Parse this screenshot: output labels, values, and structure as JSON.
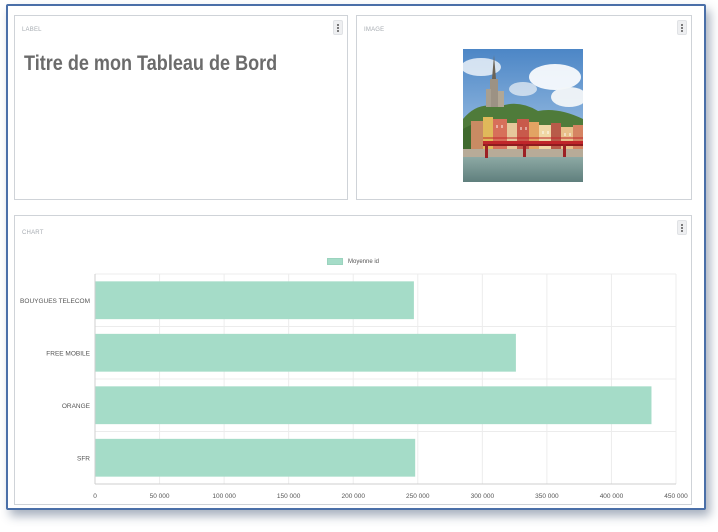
{
  "label_card": {
    "section_label": "LABEL",
    "title": "Titre de mon Tableau de Bord"
  },
  "image_card": {
    "section_label": "IMAGE",
    "image_alt": "Lyon"
  },
  "chart_card": {
    "section_label": "CHART"
  },
  "chart_data": {
    "type": "bar",
    "orientation": "horizontal",
    "categories": [
      "BOUYGUES TELECOM",
      "FREE MOBILE",
      "ORANGE",
      "SFR"
    ],
    "series": [
      {
        "name": "Moyenne id",
        "values": [
          247000,
          326000,
          431000,
          248000
        ],
        "color": "#a5dcc8"
      }
    ],
    "xlim": [
      0,
      450000
    ],
    "xticks": [
      0,
      50000,
      100000,
      150000,
      200000,
      250000,
      300000,
      350000,
      400000,
      450000
    ],
    "xtick_labels": [
      "0",
      "50 000",
      "100 000",
      "150 000",
      "200 000",
      "250 000",
      "300 000",
      "350 000",
      "400 000",
      "450 000"
    ],
    "grid": true,
    "legend": "top-center"
  }
}
